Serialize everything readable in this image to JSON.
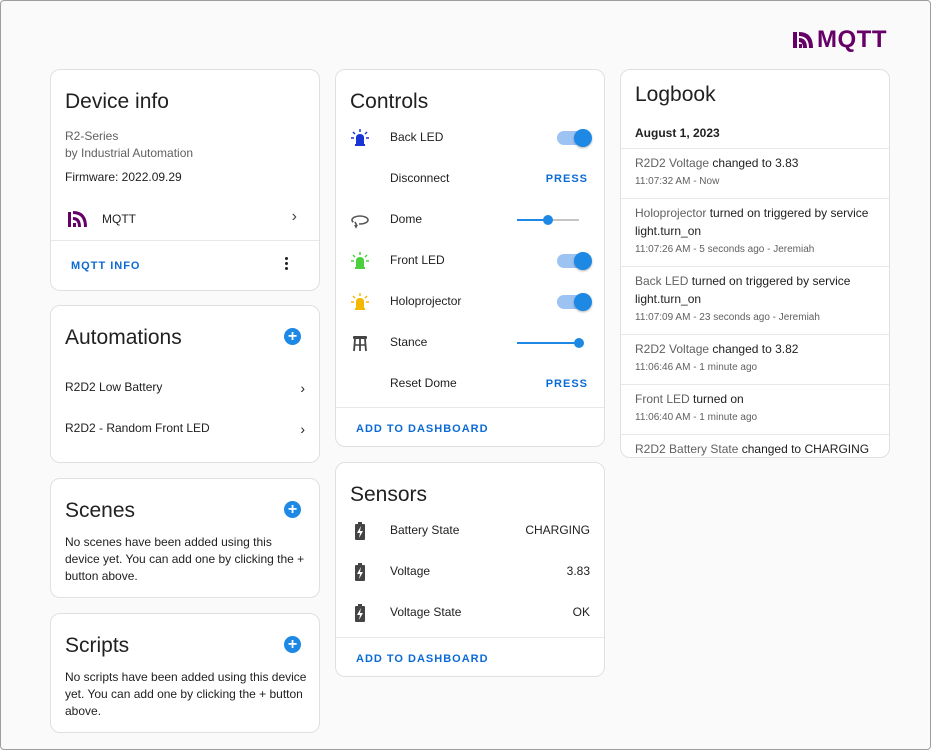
{
  "brand": {
    "logo_text": "MQTT",
    "color": "#660066"
  },
  "device_info": {
    "title": "Device info",
    "model": "R2-Series",
    "manufacturer": "by Industrial Automation",
    "firmware": "Firmware: 2022.09.29",
    "integration": "MQTT",
    "action": "MQTT INFO"
  },
  "automations": {
    "title": "Automations",
    "items": [
      {
        "label": "R2D2 Low Battery"
      },
      {
        "label": "R2D2 - Random Front LED"
      }
    ]
  },
  "scenes": {
    "title": "Scenes",
    "empty_text": "No scenes have been added using this device yet. You can add one by clicking the + button above."
  },
  "scripts": {
    "title": "Scripts",
    "empty_text": "No scripts have been added using this device yet. You can add one by clicking the + button above."
  },
  "controls": {
    "title": "Controls",
    "items": [
      {
        "label": "Back LED",
        "icon": "led-icon",
        "icon_color": "#1a35d6",
        "kind": "toggle",
        "state": "on"
      },
      {
        "label": "Disconnect",
        "kind": "button",
        "action": "PRESS"
      },
      {
        "label": "Dome",
        "icon": "rotate-icon",
        "kind": "slider",
        "level": 0.5
      },
      {
        "label": "Front LED",
        "icon": "led-icon",
        "icon_color": "#4ccf3f",
        "kind": "toggle",
        "state": "on"
      },
      {
        "label": "Holoprojector",
        "icon": "led-icon",
        "icon_color": "#f5b800",
        "kind": "toggle",
        "state": "on"
      },
      {
        "label": "Stance",
        "icon": "stool-icon",
        "kind": "slider",
        "level": 1.0
      },
      {
        "label": "Reset Dome",
        "kind": "button",
        "action": "PRESS"
      }
    ],
    "add_label": "ADD TO DASHBOARD"
  },
  "sensors": {
    "title": "Sensors",
    "items": [
      {
        "label": "Battery State",
        "value": "CHARGING",
        "icon": "battery-charging-icon"
      },
      {
        "label": "Voltage",
        "value": "3.83",
        "icon": "battery-charging-icon"
      },
      {
        "label": "Voltage State",
        "value": "OK",
        "icon": "battery-charging-icon"
      }
    ],
    "add_label": "ADD TO DASHBOARD"
  },
  "logbook": {
    "title": "Logbook",
    "date": "August 1, 2023",
    "entries": [
      {
        "entity": "R2D2 Voltage",
        "text": " changed to 3.83",
        "meta": "11:07:32 AM - Now"
      },
      {
        "entity": "Holoprojector",
        "text": " turned on triggered by service light.turn_on",
        "meta": "11:07:26 AM - 5 seconds ago - Jeremiah"
      },
      {
        "entity": "Back LED",
        "text": " turned on triggered by service light.turn_on",
        "meta": "11:07:09 AM - 23 seconds ago - Jeremiah"
      },
      {
        "entity": "R2D2 Voltage",
        "text": " changed to 3.82",
        "meta": "11:06:46 AM - 1 minute ago"
      },
      {
        "entity": "Front LED",
        "text": " turned on",
        "meta": "11:06:40 AM - 1 minute ago"
      },
      {
        "entity": "R2D2 Battery State",
        "text": " changed to CHARGING",
        "meta": ""
      }
    ]
  }
}
